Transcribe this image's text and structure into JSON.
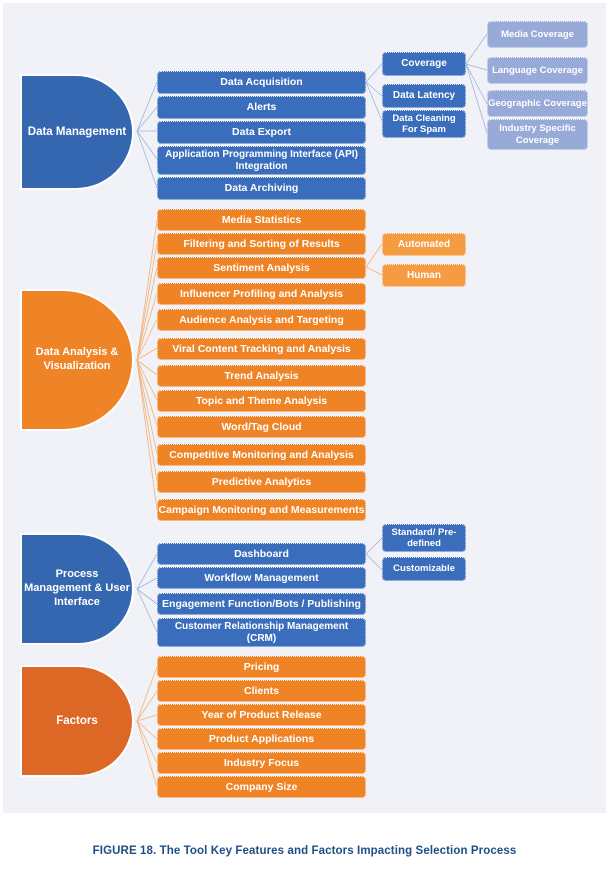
{
  "figure": {
    "caption": "FIGURE 18. The Tool Key Features and Factors Impacting Selection Process",
    "background_color": "#f1f2f7",
    "caption_color": "#1f4e87"
  },
  "colors": {
    "blue_root": "#3567b0",
    "blue_node": "#3a6ebc",
    "light_blue_node": "#97aad8",
    "orange_root": "#ef8427",
    "orange_node": "#ef8427",
    "orange_light_node": "#f59b42",
    "dark_orange_root": "#dd6826"
  },
  "branches": [
    {
      "id": "data-management",
      "root": "Data Management",
      "root_color": "#3567b0",
      "level2": [
        "Data Acquisition",
        "Alerts",
        "Data Export",
        "Application Programming Interface (API) Integration",
        "Data Archiving"
      ],
      "level3": [
        "Coverage",
        "Data Latency",
        "Data Cleaning For Spam"
      ],
      "level4": [
        "Media Coverage",
        "Language Coverage",
        "Geographic Coverage",
        "Industry Specific Coverage"
      ]
    },
    {
      "id": "data-analysis-visualization",
      "root": "Data Analysis & Visualization",
      "root_color": "#ef8427",
      "level2": [
        "Media Statistics",
        "Filtering and Sorting of Results",
        "Sentiment Analysis",
        "Influencer Profiling and Analysis",
        "Audience Analysis and Targeting",
        "Viral Content Tracking and Analysis",
        "Trend Analysis",
        "Topic and Theme Analysis",
        "Word/Tag Cloud",
        "Competitive Monitoring and Analysis",
        "Predictive Analytics",
        "Campaign Monitoring and Measurements"
      ],
      "level3": [
        "Automated",
        "Human"
      ]
    },
    {
      "id": "process-management-user-interface",
      "root": "Process Management & User Interface",
      "root_color": "#3567b0",
      "level2": [
        "Dashboard",
        "Workflow Management",
        "Engagement Function/Bots / Publishing",
        "Customer Relationship Management (CRM)"
      ],
      "level3": [
        "Standard/ Pre-defined",
        "Customizable"
      ]
    },
    {
      "id": "factors",
      "root": "Factors",
      "root_color": "#dd6826",
      "level2": [
        "Pricing",
        "Clients",
        "Year of Product Release",
        "Product Applications",
        "Industry Focus",
        "Company Size"
      ],
      "level3": []
    }
  ]
}
